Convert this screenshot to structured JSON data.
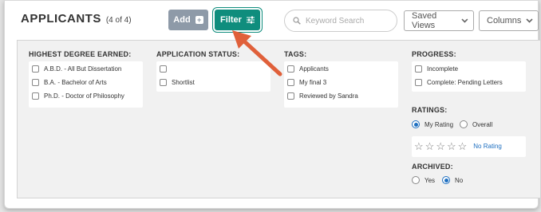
{
  "header": {
    "title": "APPLICANTS",
    "count": "(4 of 4)",
    "add_label": "Add",
    "filter_label": "Filter",
    "search_placeholder": "Keyword Search",
    "saved_views_label": "Saved Views",
    "columns_label": "Columns"
  },
  "filters": {
    "degree": {
      "title": "HIGHEST DEGREE EARNED:",
      "options": [
        "A.B.D. - All But Dissertation",
        "B.A. - Bachelor of Arts",
        "Ph.D. - Doctor of Philosophy"
      ]
    },
    "status": {
      "title": "APPLICATION STATUS:",
      "options": [
        "",
        "Shortlist"
      ]
    },
    "tags": {
      "title": "TAGS:",
      "options": [
        "Applicants",
        "My final 3",
        "Reviewed by Sandra"
      ]
    },
    "progress": {
      "title": "PROGRESS:",
      "options": [
        "Incomplete",
        "Complete: Pending Letters"
      ]
    },
    "ratings": {
      "title": "RATINGS:",
      "options": [
        "My Rating",
        "Overall"
      ],
      "selected": "My Rating",
      "no_rating_label": "No Rating",
      "star_count": 5
    },
    "archived": {
      "title": "ARCHIVED:",
      "options": [
        "Yes",
        "No"
      ],
      "selected": "No"
    }
  },
  "colors": {
    "filter_button": "#0f8d7d",
    "add_button": "#8e9aa8",
    "accent_blue": "#1e6fc0",
    "arrow": "#e0603a"
  }
}
